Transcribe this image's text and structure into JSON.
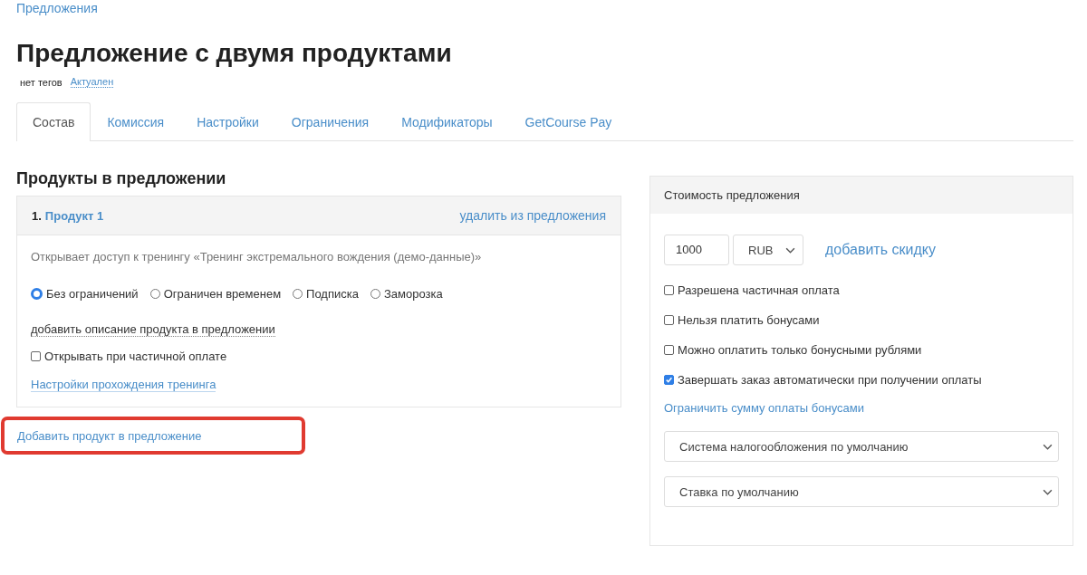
{
  "breadcrumb": "Предложения",
  "title": "Предложение с двумя продуктами",
  "tags": {
    "label": "нет тегов",
    "status": "Актуален"
  },
  "tabs": [
    {
      "label": "Состав",
      "selected": true
    },
    {
      "label": "Комиссия",
      "selected": false
    },
    {
      "label": "Настройки",
      "selected": false
    },
    {
      "label": "Ограничения",
      "selected": false
    },
    {
      "label": "Модификаторы",
      "selected": false
    },
    {
      "label": "GetCourse Pay",
      "selected": false
    }
  ],
  "products_section": {
    "heading": "Продукты в предложении",
    "products": [
      {
        "number": "1.",
        "name": "Продукт 1",
        "remove_link": "удалить из предложения",
        "description": "Открывает доступ к тренингу «Тренинг экстремального вождения (демо-данные)»",
        "access_options": [
          {
            "label": "Без ограничений",
            "selected": true
          },
          {
            "label": "Ограничен временем",
            "selected": false
          },
          {
            "label": "Подписка",
            "selected": false
          },
          {
            "label": "Заморозка",
            "selected": false
          }
        ],
        "add_description_link": "добавить описание продукта в предложении",
        "partial_payment": {
          "label": "Открывать при частичной оплате",
          "checked": false
        },
        "training_settings_link": "Настройки прохождения тренинга"
      }
    ],
    "add_product_link": {
      "label": "Добавить продукт в предложение",
      "highlighted": true
    }
  },
  "price_panel": {
    "header": "Стоимость предложения",
    "price": "1000",
    "currency": "RUB",
    "discount_link": "добавить скидку",
    "options": [
      {
        "label": "Разрешена частичная оплата",
        "checked": false
      },
      {
        "label": "Нельзя платить бонусами",
        "checked": false
      },
      {
        "label": "Можно оплатить только бонусными рублями",
        "checked": false
      },
      {
        "label": "Завершать заказ автоматически при получении оплаты",
        "checked": true
      }
    ],
    "bonus_limit_link": "Ограничить сумму оплаты бонусами",
    "selects": [
      {
        "value": "Система налогообложения по умолчанию"
      },
      {
        "value": "Ставка по умолчанию"
      }
    ]
  }
}
